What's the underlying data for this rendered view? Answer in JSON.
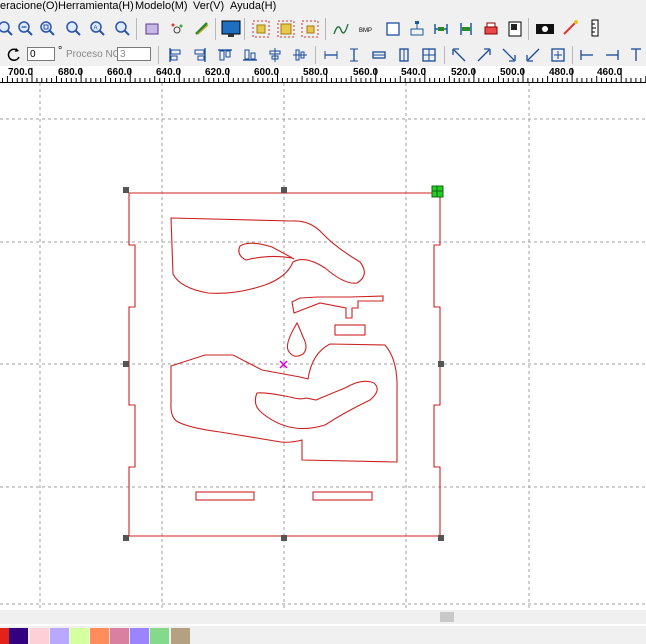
{
  "menus": [
    "eracione(O)",
    "Herramienta(H)",
    "Modelo(M)",
    "Ver(V)",
    "Ayuda(H)"
  ],
  "toolbar_top": {
    "icons": [
      "zoom-in-icon",
      "zoom-out-icon",
      "zoom-window-icon",
      "zoom-page-icon",
      "zoom-all-icon",
      "zoom-fit-icon",
      "model-icon",
      "node-icon",
      "curve-edit-icon",
      "monitor-icon",
      "array-icon",
      "align-icon",
      "group-icon",
      "polyline-icon",
      "bmp-icon",
      "rectangle-icon",
      "node-edit-icon",
      "distance-icon",
      "measure-icon",
      "print-icon",
      "doc-icon",
      "camera-icon",
      "laser-pointer-icon",
      "ruler-icon"
    ],
    "bmp_label": "BMP"
  },
  "toolbar_bottom": {
    "rotate_value": "0",
    "degree_symbol": "°",
    "proceso_label": "Proceso NO:",
    "proceso_value": "3",
    "icons": [
      "align-left-icon",
      "align-right-icon",
      "align-top-icon",
      "align-bottom-icon",
      "center-h-icon",
      "center-v-icon",
      "same-width-icon",
      "same-height-icon",
      "same-size-icon",
      "equal-gap-icon",
      "grid-icon",
      "arrow-nw-icon",
      "arrow-ne-icon",
      "arrow-se-icon",
      "arrow-sw-icon",
      "move-icon",
      "dim-left-icon",
      "dim-right-icon",
      "dim-top-icon"
    ]
  },
  "ruler": {
    "labels": [
      "700.0",
      "680.0",
      "660.0",
      "640.0",
      "620.0",
      "600.0",
      "580.0",
      "560.0",
      "540.0",
      "520.0",
      "500.0",
      "480.0",
      "460.0"
    ]
  },
  "palette": {
    "colors": [
      "#e2231a",
      "#33007f",
      "#ffcfd8",
      "#b8a8ff",
      "#d6ffa0",
      "#ff8c5a",
      "#d97fa0",
      "#9a84ff",
      "#84d98b",
      "#b5a181"
    ]
  },
  "colors": {
    "shape": "#cc2222",
    "handle": "#555555",
    "active_handle": "#22cc22",
    "center_mark": "#dd00dd",
    "grid": "#a0a0a0"
  }
}
